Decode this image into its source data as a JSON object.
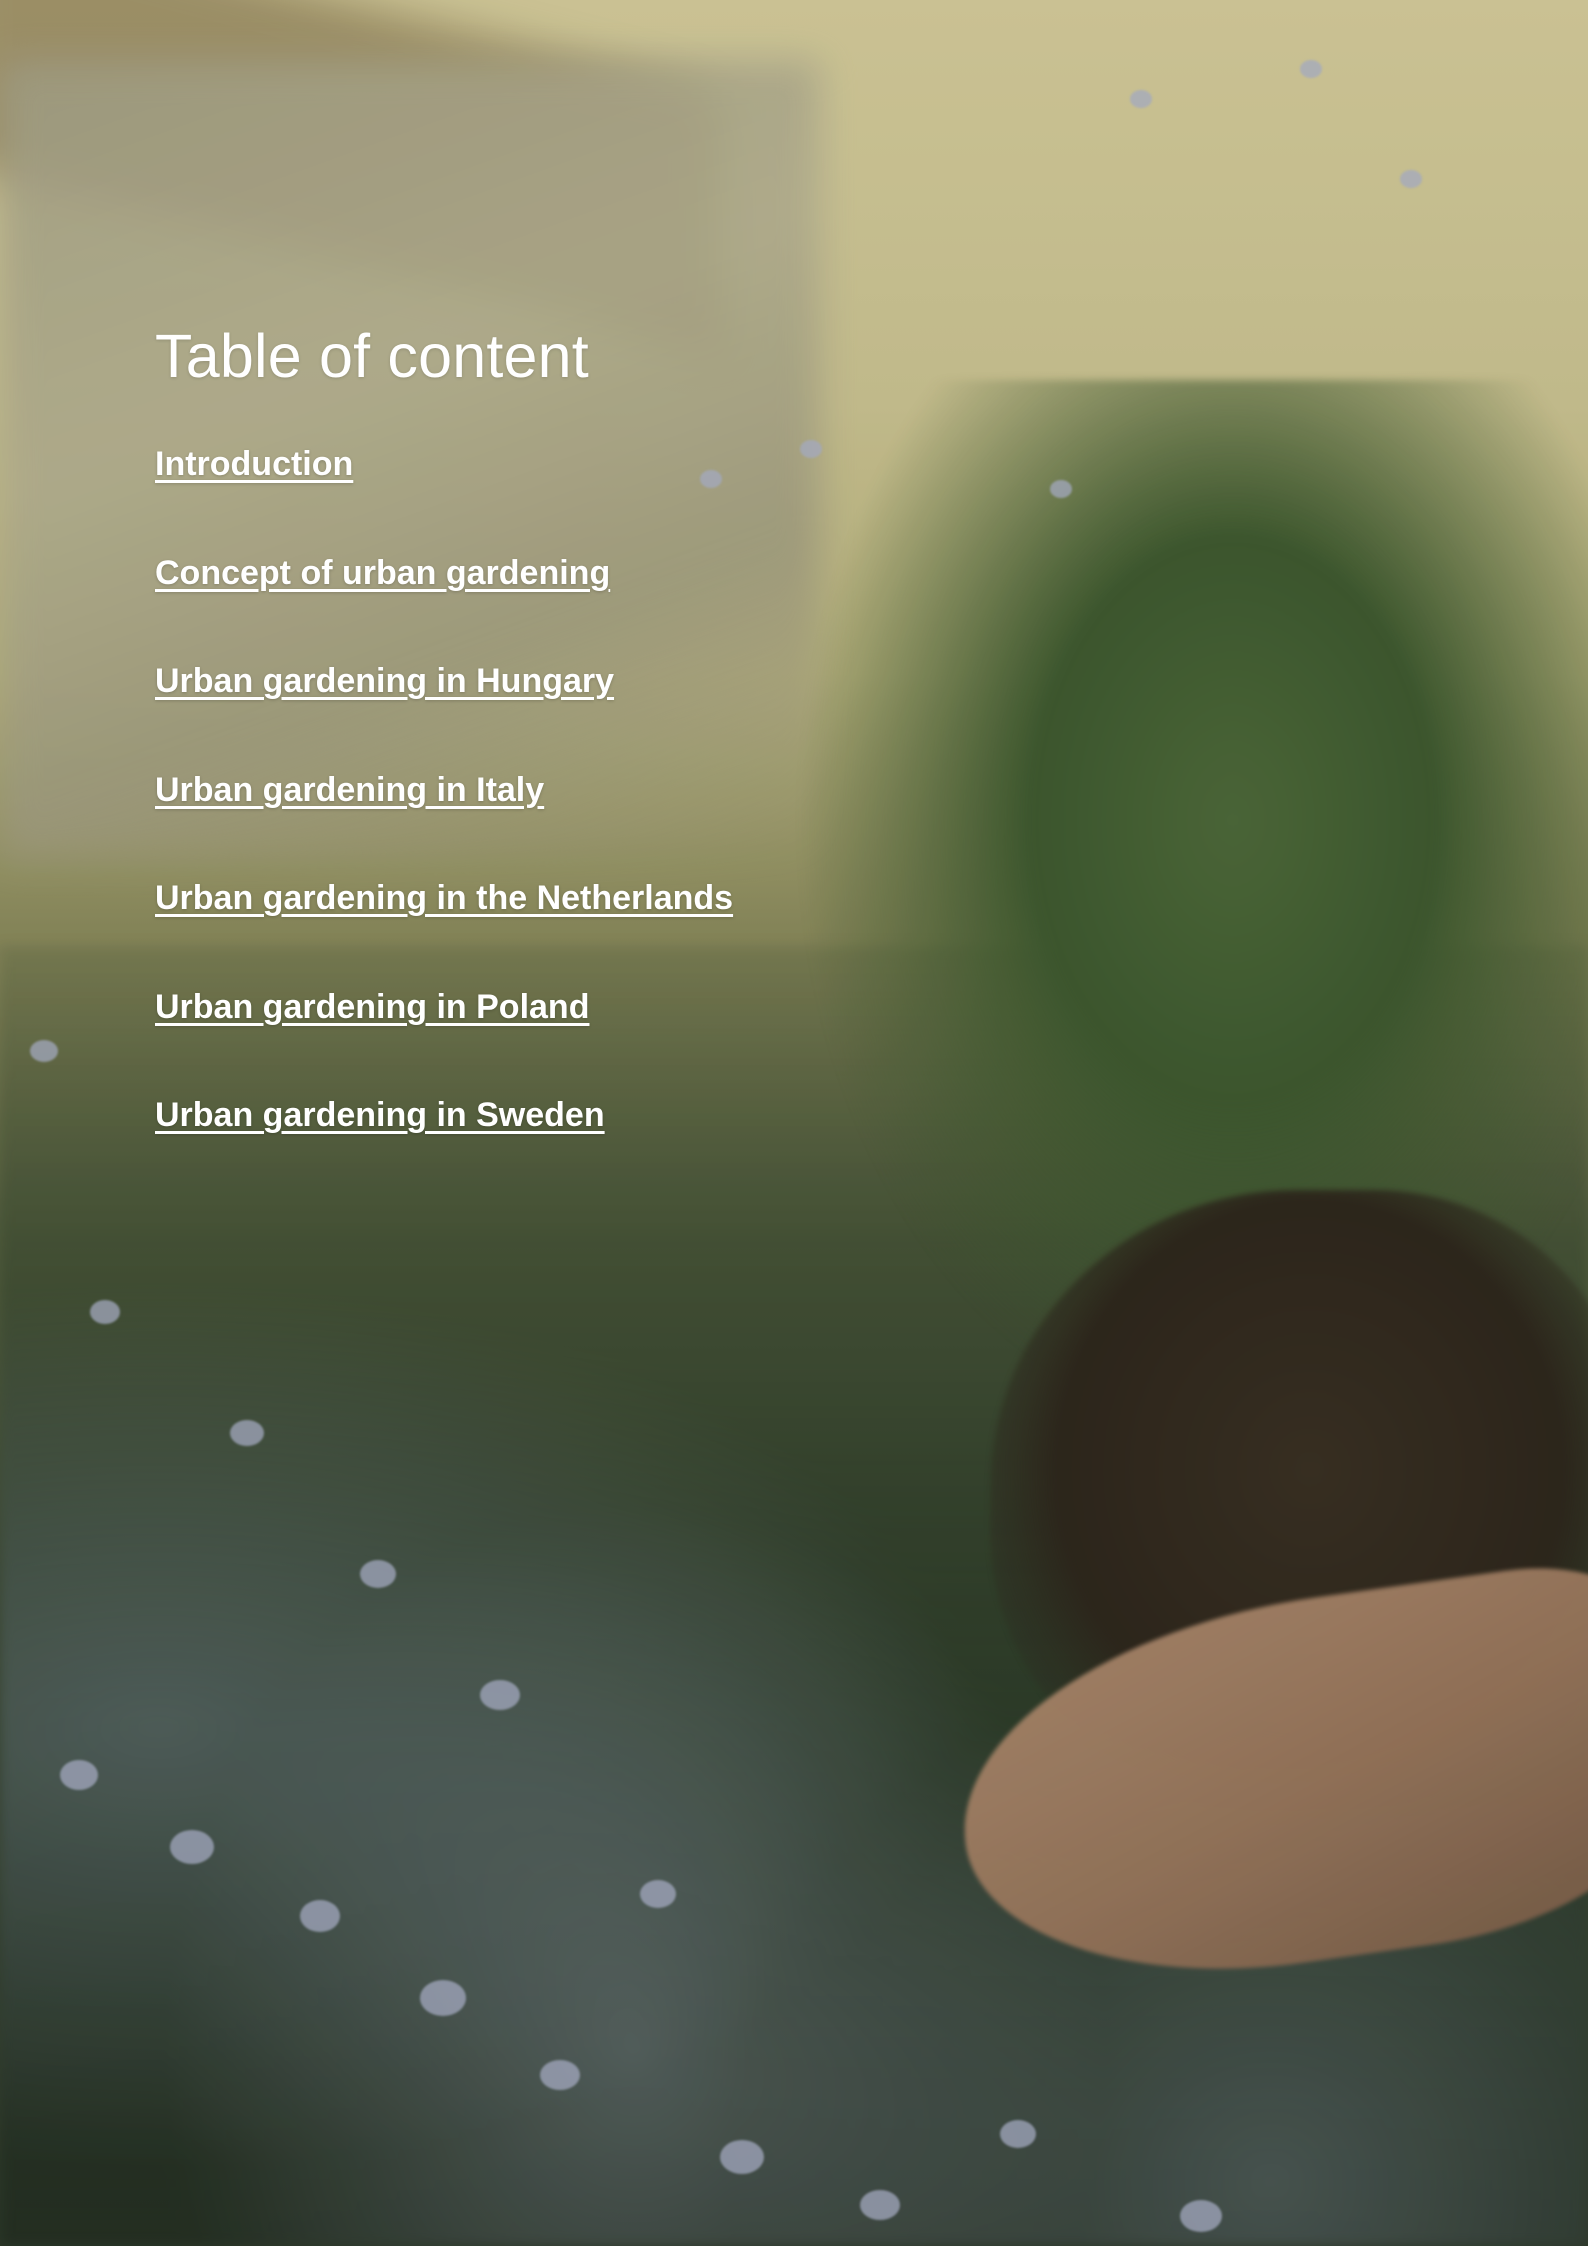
{
  "page": {
    "title": "Table of content"
  },
  "toc": {
    "items": [
      {
        "label": "Introduction"
      },
      {
        "label": "Concept of urban gardening"
      },
      {
        "label": "Urban gardening in Hungary"
      },
      {
        "label": "Urban gardening in Italy"
      },
      {
        "label": "Urban gardening in the Netherlands"
      },
      {
        "label": "Urban gardening in Poland"
      },
      {
        "label": "Urban gardening in Sweden"
      }
    ]
  },
  "colors": {
    "text": "#ffffff",
    "background_top": "#d9cf9e",
    "background_bottom": "#2f3a2a"
  }
}
